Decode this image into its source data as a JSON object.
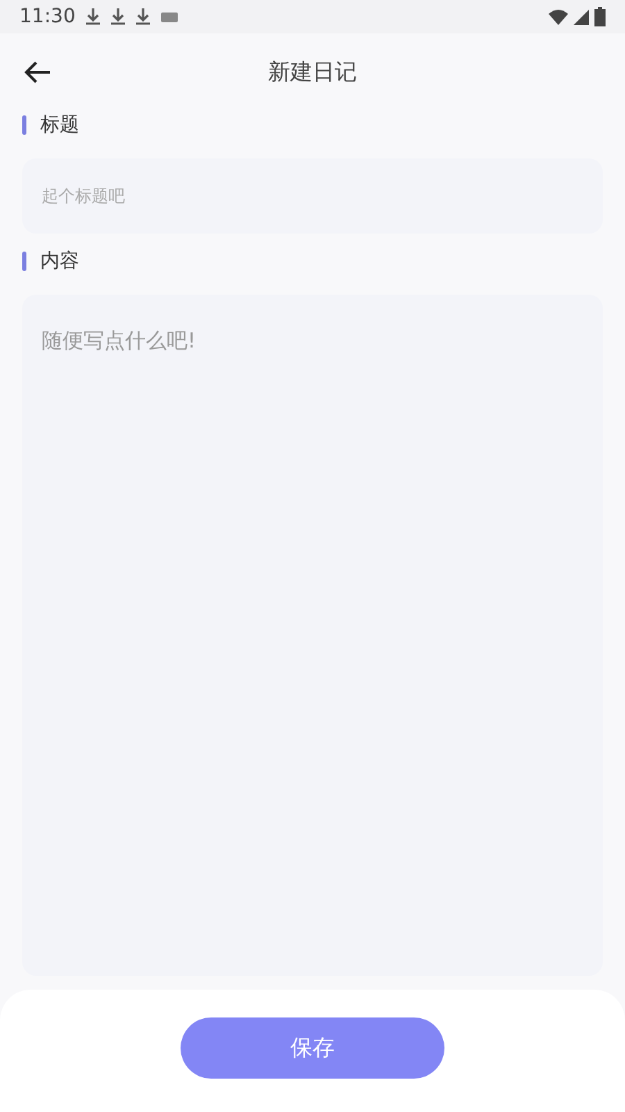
{
  "status_bar": {
    "time": "11:30"
  },
  "header": {
    "title": "新建日记"
  },
  "sections": [
    {
      "label": "标题",
      "kind": "line",
      "placeholder": "起个标题吧"
    },
    {
      "label": "内容",
      "kind": "area",
      "placeholder": "随便写点什么吧!"
    }
  ],
  "save_button": {
    "label": "保存"
  }
}
